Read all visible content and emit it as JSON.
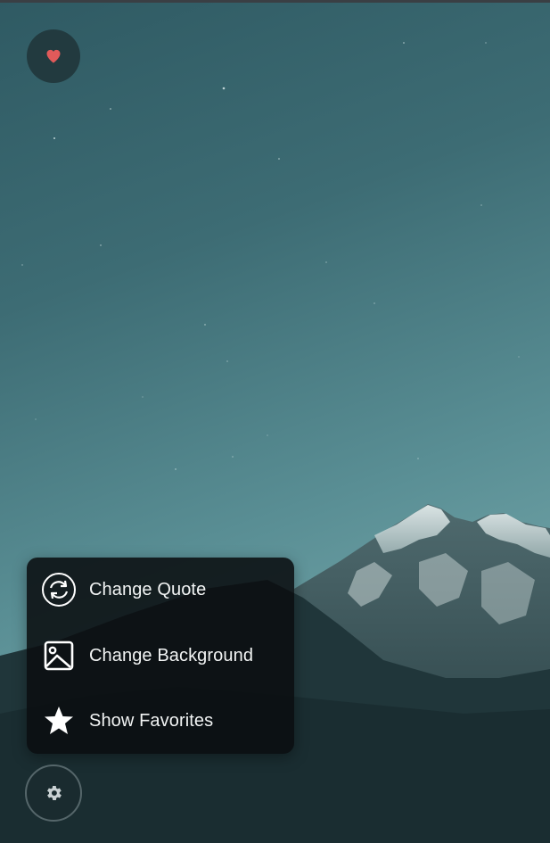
{
  "menu": {
    "items": [
      {
        "label": "Change Quote",
        "icon": "refresh-circle-icon"
      },
      {
        "label": "Change Background",
        "icon": "image-icon"
      },
      {
        "label": "Show Favorites",
        "icon": "star-icon"
      }
    ]
  },
  "favorite_button": {
    "icon": "heart-icon",
    "icon_color": "#e05a5a"
  },
  "settings_button": {
    "icon": "gear-icon"
  }
}
